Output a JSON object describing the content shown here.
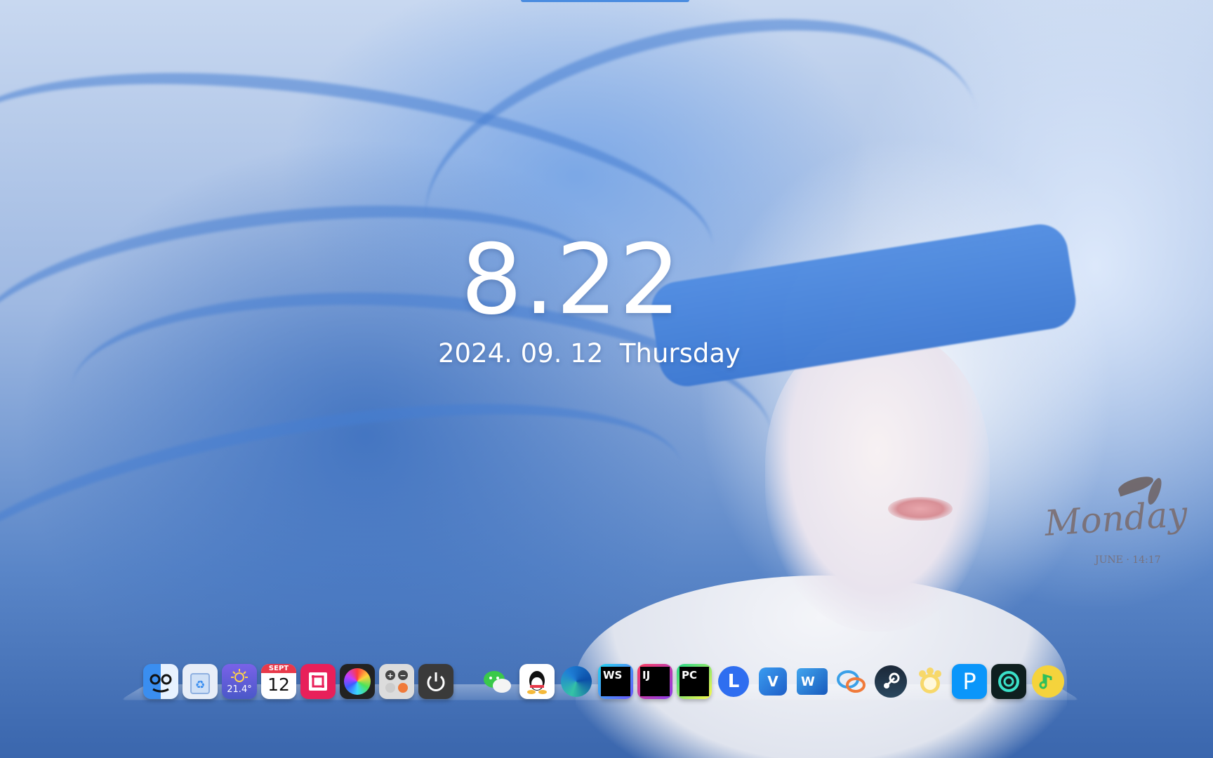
{
  "lockscreen": {
    "time": "8.22",
    "date": "2024. 09. 12  Thursday"
  },
  "widget": {
    "day": "Monday",
    "subtitle": "JUNE · 14:17"
  },
  "dock": {
    "calendar_month": "SEPT",
    "calendar_day": "12",
    "weather_temp": "21.4°",
    "apps": [
      {
        "name": "finder",
        "color": "#3a8ef0"
      },
      {
        "name": "recycle-bin",
        "color": "#e8eef8"
      },
      {
        "name": "weather",
        "color": "#6a58d8"
      },
      {
        "name": "calendar",
        "color": "#ffffff"
      },
      {
        "name": "photo-crop",
        "color": "#e8205a"
      },
      {
        "name": "color-picker",
        "color": "#222222"
      },
      {
        "name": "calculator",
        "color": "#dcdcdc"
      },
      {
        "name": "power",
        "color": "#3a3a3a"
      },
      {
        "name": "wechat",
        "color": "#ffffff"
      },
      {
        "name": "qq",
        "color": "#ffffff"
      },
      {
        "name": "edge",
        "color": "#1f7fd6"
      },
      {
        "name": "webstorm",
        "color": "#000000"
      },
      {
        "name": "intellij",
        "color": "#000000"
      },
      {
        "name": "pycharm",
        "color": "#000000"
      },
      {
        "name": "lark",
        "color": "#2f6ef0"
      },
      {
        "name": "vscode",
        "color": "#2a8ce0"
      },
      {
        "name": "word",
        "color": "#2b5cb8"
      },
      {
        "name": "chat",
        "color": "#3aa0e8"
      },
      {
        "name": "steam",
        "color": "#1b2838"
      },
      {
        "name": "baidu-netdisk",
        "color": "#f7d86a"
      },
      {
        "name": "pixiv",
        "color": "#0a96fa"
      },
      {
        "name": "chatgpt",
        "color": "#0f1f1f"
      },
      {
        "name": "qq-music",
        "color": "#f5d33c"
      }
    ],
    "labels": {
      "webstorm": "WS",
      "intellij": "IJ",
      "pycharm": "PC",
      "lark": "L",
      "vscode": "V",
      "word": "W",
      "pixiv": "P"
    }
  }
}
